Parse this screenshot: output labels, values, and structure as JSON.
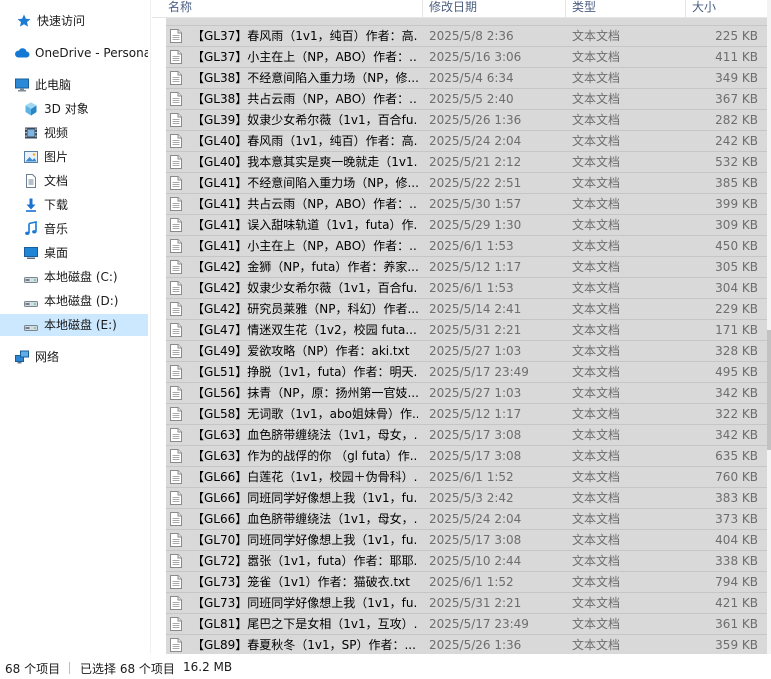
{
  "nav": {
    "items": [
      {
        "label": "快速访问",
        "icon": "star-icon",
        "selected": false
      },
      {
        "label": "OneDrive - Persona",
        "icon": "cloud-icon",
        "selected": false
      },
      {
        "label": "此电脑",
        "icon": "computer-icon",
        "selected": false
      },
      {
        "label": "3D 对象",
        "icon": "cube-icon",
        "selected": false
      },
      {
        "label": "视频",
        "icon": "video-icon",
        "selected": false
      },
      {
        "label": "图片",
        "icon": "picture-icon",
        "selected": false
      },
      {
        "label": "文档",
        "icon": "document-icon",
        "selected": false
      },
      {
        "label": "下载",
        "icon": "download-icon",
        "selected": false
      },
      {
        "label": "音乐",
        "icon": "music-icon",
        "selected": false
      },
      {
        "label": "桌面",
        "icon": "desktop-icon",
        "selected": false
      },
      {
        "label": "本地磁盘 (C:)",
        "icon": "drive-icon",
        "selected": false
      },
      {
        "label": "本地磁盘 (D:)",
        "icon": "drive-icon",
        "selected": false
      },
      {
        "label": "本地磁盘 (E:)",
        "icon": "drive-icon",
        "selected": true
      },
      {
        "label": "网络",
        "icon": "network-icon",
        "selected": false
      }
    ]
  },
  "columns": {
    "name": "名称",
    "date": "修改日期",
    "type": "类型",
    "size": "大小"
  },
  "files": [
    {
      "name": "【GL37】春风雨（1v1，纯百）作者：高...",
      "date": "2025/5/8 2:36",
      "type": "文本文档",
      "size": "225 KB"
    },
    {
      "name": "【GL37】小主在上（NP，ABO）作者：...",
      "date": "2025/5/16 3:06",
      "type": "文本文档",
      "size": "411 KB"
    },
    {
      "name": "【GL38】不经意间陷入重力场（NP，修...",
      "date": "2025/5/4 6:34",
      "type": "文本文档",
      "size": "349 KB"
    },
    {
      "name": "【GL38】共占云雨（NP，ABO）作者：...",
      "date": "2025/5/5 2:40",
      "type": "文本文档",
      "size": "367 KB"
    },
    {
      "name": "【GL39】奴隶少女希尔薇（1v1，百合fu...",
      "date": "2025/5/26 1:36",
      "type": "文本文档",
      "size": "282 KB"
    },
    {
      "name": "【GL40】春风雨（1v1，纯百）作者：高...",
      "date": "2025/5/24 2:04",
      "type": "文本文档",
      "size": "242 KB"
    },
    {
      "name": "【GL40】我本意其实是爽一晚就走（1v1...",
      "date": "2025/5/21 2:12",
      "type": "文本文档",
      "size": "532 KB"
    },
    {
      "name": "【GL41】不经意间陷入重力场（NP，修...",
      "date": "2025/5/22 2:51",
      "type": "文本文档",
      "size": "385 KB"
    },
    {
      "name": "【GL41】共占云雨（NP，ABO）作者：...",
      "date": "2025/5/30 1:57",
      "type": "文本文档",
      "size": "399 KB"
    },
    {
      "name": "【GL41】误入甜味轨道（1v1，futa）作...",
      "date": "2025/5/29 1:30",
      "type": "文本文档",
      "size": "309 KB"
    },
    {
      "name": "【GL41】小主在上（NP，ABO）作者：...",
      "date": "2025/6/1 1:53",
      "type": "文本文档",
      "size": "450 KB"
    },
    {
      "name": "【GL42】金狮（NP，futa）作者：养家...",
      "date": "2025/5/12 1:17",
      "type": "文本文档",
      "size": "305 KB"
    },
    {
      "name": "【GL42】奴隶少女希尔薇（1v1，百合fu...",
      "date": "2025/6/1 1:53",
      "type": "文本文档",
      "size": "304 KB"
    },
    {
      "name": "【GL42】研究员莱雅（NP，科幻）作者...",
      "date": "2025/5/14 2:41",
      "type": "文本文档",
      "size": "229 KB"
    },
    {
      "name": "【GL47】情迷双生花（1v2，校园 futa...",
      "date": "2025/5/31 2:21",
      "type": "文本文档",
      "size": "171 KB"
    },
    {
      "name": "【GL49】爱欲攻略（NP）作者：aki.txt",
      "date": "2025/5/27 1:03",
      "type": "文本文档",
      "size": "328 KB"
    },
    {
      "name": "【GL51】挣脱（1v1，futa）作者：明天...",
      "date": "2025/5/17 23:49",
      "type": "文本文档",
      "size": "495 KB"
    },
    {
      "name": "【GL56】抹青（NP，原：扬州第一官妓...",
      "date": "2025/5/27 1:03",
      "type": "文本文档",
      "size": "342 KB"
    },
    {
      "name": "【GL58】无词歌（1v1，abo姐妹骨）作...",
      "date": "2025/5/12 1:17",
      "type": "文本文档",
      "size": "322 KB"
    },
    {
      "name": "【GL63】血色脐带缠绕法（1v1，母女，...",
      "date": "2025/5/17 3:08",
      "type": "文本文档",
      "size": "342 KB"
    },
    {
      "name": "【GL63】作为的战俘的你 （gl futa）作...",
      "date": "2025/5/17 3:08",
      "type": "文本文档",
      "size": "635 KB"
    },
    {
      "name": "【GL66】白莲花（1v1，校园＋伪骨科）...",
      "date": "2025/6/1 1:52",
      "type": "文本文档",
      "size": "760 KB"
    },
    {
      "name": "【GL66】同班同学好像想上我（1v1，fu...",
      "date": "2025/5/3 2:42",
      "type": "文本文档",
      "size": "383 KB"
    },
    {
      "name": "【GL66】血色脐带缠绕法（1v1，母女，...",
      "date": "2025/5/24 2:04",
      "type": "文本文档",
      "size": "373 KB"
    },
    {
      "name": "【GL70】同班同学好像想上我（1v1，fu...",
      "date": "2025/5/17 3:08",
      "type": "文本文档",
      "size": "404 KB"
    },
    {
      "name": "【GL72】嚣张（1v1，futa）作者：耶耶...",
      "date": "2025/5/10 2:44",
      "type": "文本文档",
      "size": "338 KB"
    },
    {
      "name": "【GL73】笼雀（1v1）作者：猫破衣.txt",
      "date": "2025/6/1 1:52",
      "type": "文本文档",
      "size": "794 KB"
    },
    {
      "name": "【GL73】同班同学好像想上我（1v1，fu...",
      "date": "2025/5/31 2:21",
      "type": "文本文档",
      "size": "421 KB"
    },
    {
      "name": "【GL81】尾巴之下是女相（1v1，互攻）...",
      "date": "2025/5/17 23:49",
      "type": "文本文档",
      "size": "361 KB"
    },
    {
      "name": "【GL89】春夏秋冬（1v1，SP）作者：...",
      "date": "2025/5/26 1:36",
      "type": "文本文档",
      "size": "359 KB"
    }
  ],
  "status": {
    "count": "68 个项目",
    "selected": "已选择 68 个项目",
    "size": "16.2 MB"
  }
}
